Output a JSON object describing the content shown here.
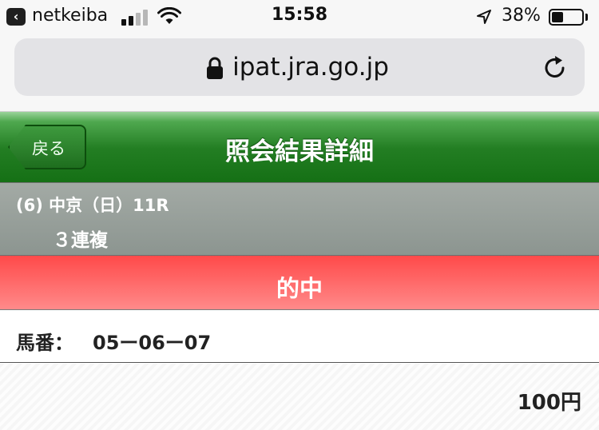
{
  "status_bar": {
    "app_name": "netkeiba",
    "time": "15:58",
    "battery_percent": "38%",
    "battery_level": 0.38,
    "signal_bars_filled": 2,
    "signal_bars_total": 4
  },
  "browser": {
    "url": "ipat.jra.go.jp"
  },
  "header": {
    "back_label": "戻る",
    "title": "照会結果詳細"
  },
  "race": {
    "info": "(6) 中京（日）11R",
    "bet_type": "３連複"
  },
  "result": {
    "label": "的中"
  },
  "bet": {
    "number_label": "馬番：",
    "numbers": "05ー06ー07",
    "amount": "100円"
  },
  "colors": {
    "header_green": "#1f7a1f",
    "race_band_gray": "#939b96",
    "result_red": "#ff5a5a"
  },
  "icons": [
    "back-arrow-icon",
    "signal-icon",
    "wifi-icon",
    "location-arrow-icon",
    "battery-icon",
    "lock-icon",
    "reload-icon"
  ]
}
